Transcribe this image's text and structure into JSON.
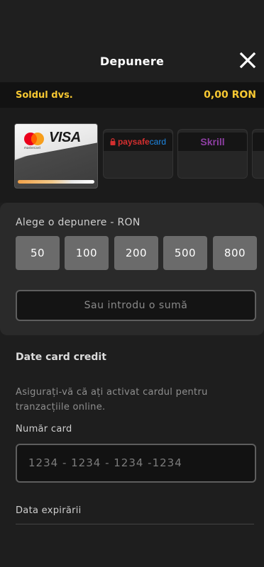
{
  "header": {
    "title": "Depunere",
    "close_icon": "close-icon"
  },
  "balance": {
    "label": "Soldul dvs.",
    "value": "0,00 RON",
    "color": "#f7c832"
  },
  "payment_methods": {
    "card": {
      "brand_left": "mastercard",
      "brand_right": "VISA"
    },
    "paysafe": {
      "part1": "paysafe",
      "part2": "card"
    },
    "skrill": {
      "label": "Skrill"
    }
  },
  "deposit": {
    "label": "Alege o depunere - RON",
    "amounts": [
      "50",
      "100",
      "200",
      "500",
      "800"
    ],
    "custom_placeholder": "Sau introdu o sumă"
  },
  "card_data": {
    "title": "Date card credit",
    "notice": "Asigurați-vă că ați activat cardul pentru tranzacțiile online.",
    "card_number_label": "Număr card",
    "card_number_placeholder": "1234 - 1234 - 1234 -1234",
    "expiry_label": "Data expirării"
  }
}
